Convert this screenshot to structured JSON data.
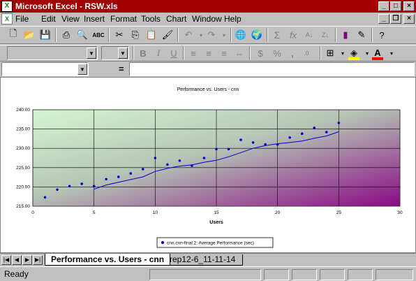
{
  "window": {
    "title": "Microsoft Excel - RSW.xls"
  },
  "menu": [
    "File",
    "Edit",
    "View",
    "Insert",
    "Format",
    "Tools",
    "Chart",
    "Window",
    "Help"
  ],
  "formula_bar": {
    "equals": "="
  },
  "chart_data": {
    "type": "scatter",
    "title": "Performance vs. Users - cnn",
    "xlabel": "Users",
    "ylabel": "",
    "xlim": [
      0,
      30
    ],
    "ylim": [
      215,
      240
    ],
    "xticks": [
      "0",
      "5",
      "10",
      "15",
      "20",
      "25",
      "30"
    ],
    "yticks": [
      "215.00",
      "220.00",
      "225.00",
      "230.00",
      "235.00",
      "240.00"
    ],
    "series": [
      {
        "name": "cnn.cnn-final.2: Average Performance (sec)",
        "x": [
          1,
          2,
          3,
          4,
          5,
          6,
          7,
          8,
          9,
          10,
          11,
          12,
          13,
          14,
          15,
          16,
          17,
          18,
          19,
          20,
          21,
          22,
          23,
          24,
          25
        ],
        "y": [
          217.3,
          219.3,
          220.2,
          220.8,
          220.2,
          222.0,
          222.6,
          223.5,
          224.6,
          227.5,
          225.8,
          226.8,
          225.5,
          227.5,
          229.8,
          229.8,
          232.2,
          231.5,
          231.0,
          231.0,
          232.8,
          233.8,
          235.3,
          234.2,
          236.6
        ]
      }
    ],
    "trendline": {
      "x": [
        5,
        6,
        7,
        8,
        9,
        10,
        11,
        12,
        13,
        14,
        15,
        16,
        17,
        18,
        19,
        20,
        21,
        22,
        23,
        24,
        25
      ],
      "y": [
        219.4,
        220.5,
        221.2,
        221.9,
        222.6,
        224.0,
        224.8,
        225.4,
        225.7,
        226.4,
        226.9,
        227.8,
        228.9,
        230.0,
        230.7,
        231.2,
        231.5,
        231.9,
        232.6,
        233.2,
        234.3
      ]
    },
    "legend_position": "bottom"
  },
  "sheet_tabs": [
    {
      "label": "Performance vs. Users - cnn",
      "active": true
    },
    {
      "label": "rep12-6_11-11-14",
      "active": false
    }
  ],
  "status": {
    "text": "Ready"
  },
  "toolbar": {
    "font_color_hex": "#ff0000",
    "fill_color_hex": "#ffff00"
  }
}
